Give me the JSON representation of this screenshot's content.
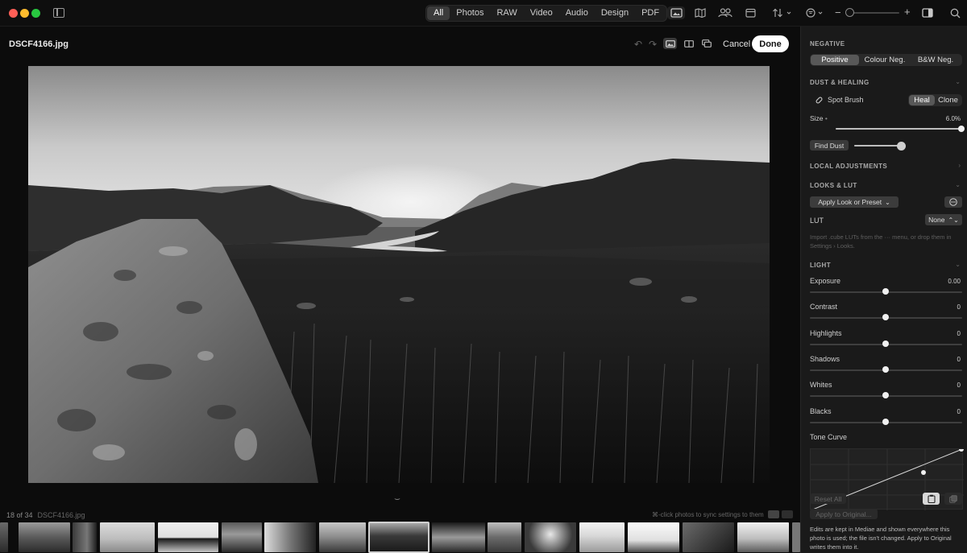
{
  "filters": [
    "All",
    "Photos",
    "RAW",
    "Video",
    "Audio",
    "Design",
    "PDF"
  ],
  "active_filter": "All",
  "toolbar": {
    "icons": [
      "photo-frame-icon",
      "map-icon",
      "people-icon",
      "calendar-icon",
      "sort-icon",
      "filter-menu-icon",
      "zoom-out-icon",
      "zoom-in-icon",
      "inspector-toggle-icon",
      "search-icon"
    ],
    "zoom_minus": "−",
    "zoom_plus": "+"
  },
  "editor": {
    "filename": "DSCF4166.jpg",
    "cancel_label": "Cancel",
    "done_label": "Done"
  },
  "filmstrip": {
    "position_text": "18 of 34",
    "filename": "DSCF4166.jpg",
    "sync_hint": "⌘-click photos to sync settings to them",
    "selected_index": 7
  },
  "panel": {
    "negative": {
      "title": "NEGATIVE",
      "options": [
        "Positive",
        "Colour Neg.",
        "B&W Neg."
      ],
      "selected": "Positive"
    },
    "dust": {
      "title": "DUST & HEALING",
      "tool_label": "Spot Brush",
      "modes": [
        "Heal",
        "Clone"
      ],
      "selected_mode": "Heal",
      "size_label": "Size",
      "size_value": "6.0%",
      "size_fraction": 1.0,
      "find_dust_label": "Find Dust",
      "find_dust_fraction": 1.0
    },
    "local_adjustments_title": "LOCAL ADJUSTMENTS",
    "looks": {
      "title": "LOOKS & LUT",
      "apply_label": "Apply Look or Preset",
      "lut_label": "LUT",
      "lut_value": "None",
      "note": "Import .cube LUTs from the ··· menu, or drop them in Settings › Looks."
    },
    "light": {
      "title": "LIGHT",
      "sliders": [
        {
          "label": "Exposure",
          "value": "0.00"
        },
        {
          "label": "Contrast",
          "value": "0"
        },
        {
          "label": "Highlights",
          "value": "0"
        },
        {
          "label": "Shadows",
          "value": "0"
        },
        {
          "label": "Whites",
          "value": "0"
        },
        {
          "label": "Blacks",
          "value": "0"
        }
      ],
      "tone_curve_label": "Tone Curve"
    },
    "footer": {
      "reset_label": "Reset All",
      "apply_original_label": "Apply to Original...",
      "note": "Edits are kept in Mediae and shown everywhere this photo is used; the file isn't changed. Apply to Original writes them into it."
    }
  }
}
